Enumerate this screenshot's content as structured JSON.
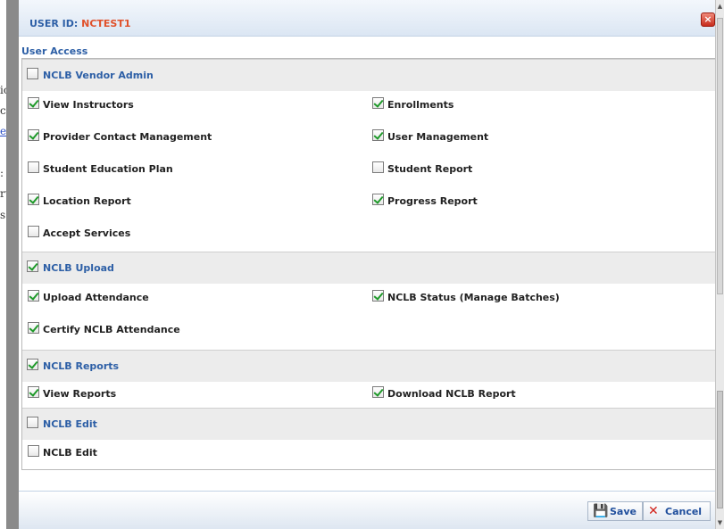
{
  "background_page": {
    "fragments": [
      "ion",
      "ct I",
      "ent",
      ":",
      "rt",
      "s"
    ]
  },
  "dialog": {
    "title_label": "USER ID:",
    "title_value": "NCTEST1",
    "close_icon": "close-icon",
    "section_title": "User Access",
    "groups": [
      {
        "label": "NCLB Vendor Admin",
        "checked": false,
        "items": [
          {
            "label": "View Instructors",
            "checked": true
          },
          {
            "label": "Enrollments",
            "checked": true
          },
          {
            "label": "Provider Contact Management",
            "checked": true
          },
          {
            "label": "User Management",
            "checked": true
          },
          {
            "label": "Student Education Plan",
            "checked": false
          },
          {
            "label": "Student Report",
            "checked": false
          },
          {
            "label": "Location Report",
            "checked": true
          },
          {
            "label": "Progress Report",
            "checked": true
          },
          {
            "label": "Accept Services",
            "checked": false
          }
        ]
      },
      {
        "label": "NCLB Upload",
        "checked": true,
        "items": [
          {
            "label": "Upload Attendance",
            "checked": true
          },
          {
            "label": "NCLB Status (Manage Batches)",
            "checked": true
          },
          {
            "label": "Certify NCLB Attendance",
            "checked": true
          }
        ]
      },
      {
        "label": "NCLB Reports",
        "checked": true,
        "items": [
          {
            "label": "View Reports",
            "checked": true
          },
          {
            "label": "Download NCLB Report",
            "checked": true
          }
        ]
      },
      {
        "label": "NCLB Edit",
        "checked": false,
        "items": [
          {
            "label": "NCLB Edit",
            "checked": false
          }
        ]
      }
    ],
    "footer": {
      "save_label": "Save",
      "save_icon": "floppy-disk-icon",
      "cancel_label": "Cancel",
      "cancel_icon": "x-icon"
    }
  },
  "colors": {
    "accent": "#2d5fa6",
    "user_id": "#e0502a",
    "check": "#1f9a2a",
    "cancel": "#d2231b"
  }
}
